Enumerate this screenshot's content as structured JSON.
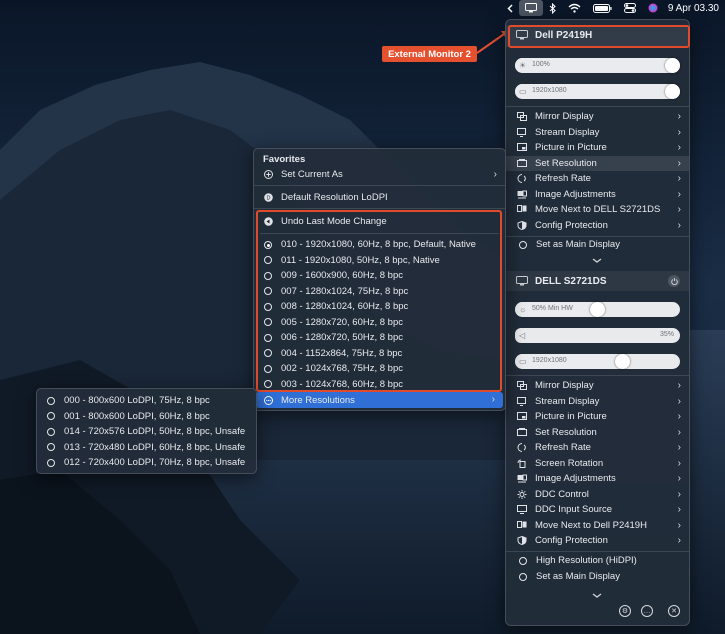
{
  "menubar": {
    "icons": [
      "chevron-left-icon",
      "display-icon",
      "bluetooth-icon",
      "wifi-icon",
      "battery-icon",
      "control-center-icon",
      "siri-icon"
    ],
    "clock": "9 Apr  03.30"
  },
  "annotation": {
    "label": "External Monitor 2",
    "color": "#e5502f"
  },
  "display1": {
    "name": "Dell P2419H",
    "brightness_label": "100%",
    "brightness_level": 1.0,
    "resolution_label": "1920x1080",
    "resolution_level": 1.0,
    "items": [
      {
        "label": "Mirror Display",
        "icon": "mirror-icon"
      },
      {
        "label": "Stream Display",
        "icon": "stream-icon"
      },
      {
        "label": "Picture in Picture",
        "icon": "pip-icon"
      },
      {
        "label": "Set Resolution",
        "icon": "resolution-icon"
      },
      {
        "label": "Refresh Rate",
        "icon": "refresh-icon"
      },
      {
        "label": "Image Adjustments",
        "icon": "image-adjust-icon"
      },
      {
        "label": "Move Next to DELL S2721DS",
        "icon": "move-icon"
      },
      {
        "label": "Config Protection",
        "icon": "shield-icon"
      }
    ],
    "main_display": "Set as Main Display"
  },
  "display2": {
    "name": "DELL S2721DS",
    "brightness_label": "50% Min HW",
    "brightness_level": 0.5,
    "volume_label": "35%",
    "volume_level": 0.35,
    "resolution_label": "1920x1080",
    "resolution_level": 0.65,
    "items": [
      {
        "label": "Mirror Display",
        "icon": "mirror-icon"
      },
      {
        "label": "Stream Display",
        "icon": "stream-icon"
      },
      {
        "label": "Picture in Picture",
        "icon": "pip-icon"
      },
      {
        "label": "Set Resolution",
        "icon": "resolution-icon"
      },
      {
        "label": "Refresh Rate",
        "icon": "refresh-icon"
      },
      {
        "label": "Screen Rotation",
        "icon": "rotation-icon"
      },
      {
        "label": "Image Adjustments",
        "icon": "image-adjust-icon"
      },
      {
        "label": "DDC Control",
        "icon": "ddc-icon"
      },
      {
        "label": "DDC Input Source",
        "icon": "input-source-icon"
      },
      {
        "label": "Move Next to Dell P2419H",
        "icon": "move-icon"
      },
      {
        "label": "Config Protection",
        "icon": "shield-icon"
      }
    ],
    "hidpi": "High Resolution (HiDPI)",
    "main_display": "Set as Main Display"
  },
  "resolution_menu": {
    "favorites_header": "Favorites",
    "set_current": "Set Current As",
    "default_lodpi": "Default Resolution LoDPI",
    "undo": "Undo Last Mode Change",
    "modes": [
      {
        "label": "010 - 1920x1080, 60Hz, 8 bpc, Default, Native",
        "selected": true
      },
      {
        "label": "011 - 1920x1080, 50Hz, 8 bpc, Native",
        "selected": false
      },
      {
        "label": "009 - 1600x900, 60Hz, 8 bpc",
        "selected": false
      },
      {
        "label": "007 - 1280x1024, 75Hz, 8 bpc",
        "selected": false
      },
      {
        "label": "008 - 1280x1024, 60Hz, 8 bpc",
        "selected": false
      },
      {
        "label": "005 - 1280x720, 60Hz, 8 bpc",
        "selected": false
      },
      {
        "label": "006 - 1280x720, 50Hz, 8 bpc",
        "selected": false
      },
      {
        "label": "004 - 1152x864, 75Hz, 8 bpc",
        "selected": false
      },
      {
        "label": "002 - 1024x768, 75Hz, 8 bpc",
        "selected": false
      },
      {
        "label": "003 - 1024x768, 60Hz, 8 bpc",
        "selected": false
      }
    ],
    "more": "More Resolutions"
  },
  "more_menu": {
    "modes": [
      "000 - 800x600 LoDPI, 75Hz, 8 bpc",
      "001 - 800x600 LoDPI, 60Hz, 8 bpc",
      "014 - 720x576 LoDPI, 50Hz, 8 bpc, Unsafe",
      "013 - 720x480 LoDPI, 60Hz, 8 bpc, Unsafe",
      "012 - 720x400 LoDPI, 70Hz, 8 bpc, Unsafe"
    ]
  },
  "footer": {
    "icons": [
      "gear-icon",
      "more-icon",
      "close-icon"
    ]
  },
  "colors": {
    "accent": "#2f6fd6",
    "highlight_red": "#e04b2e"
  }
}
